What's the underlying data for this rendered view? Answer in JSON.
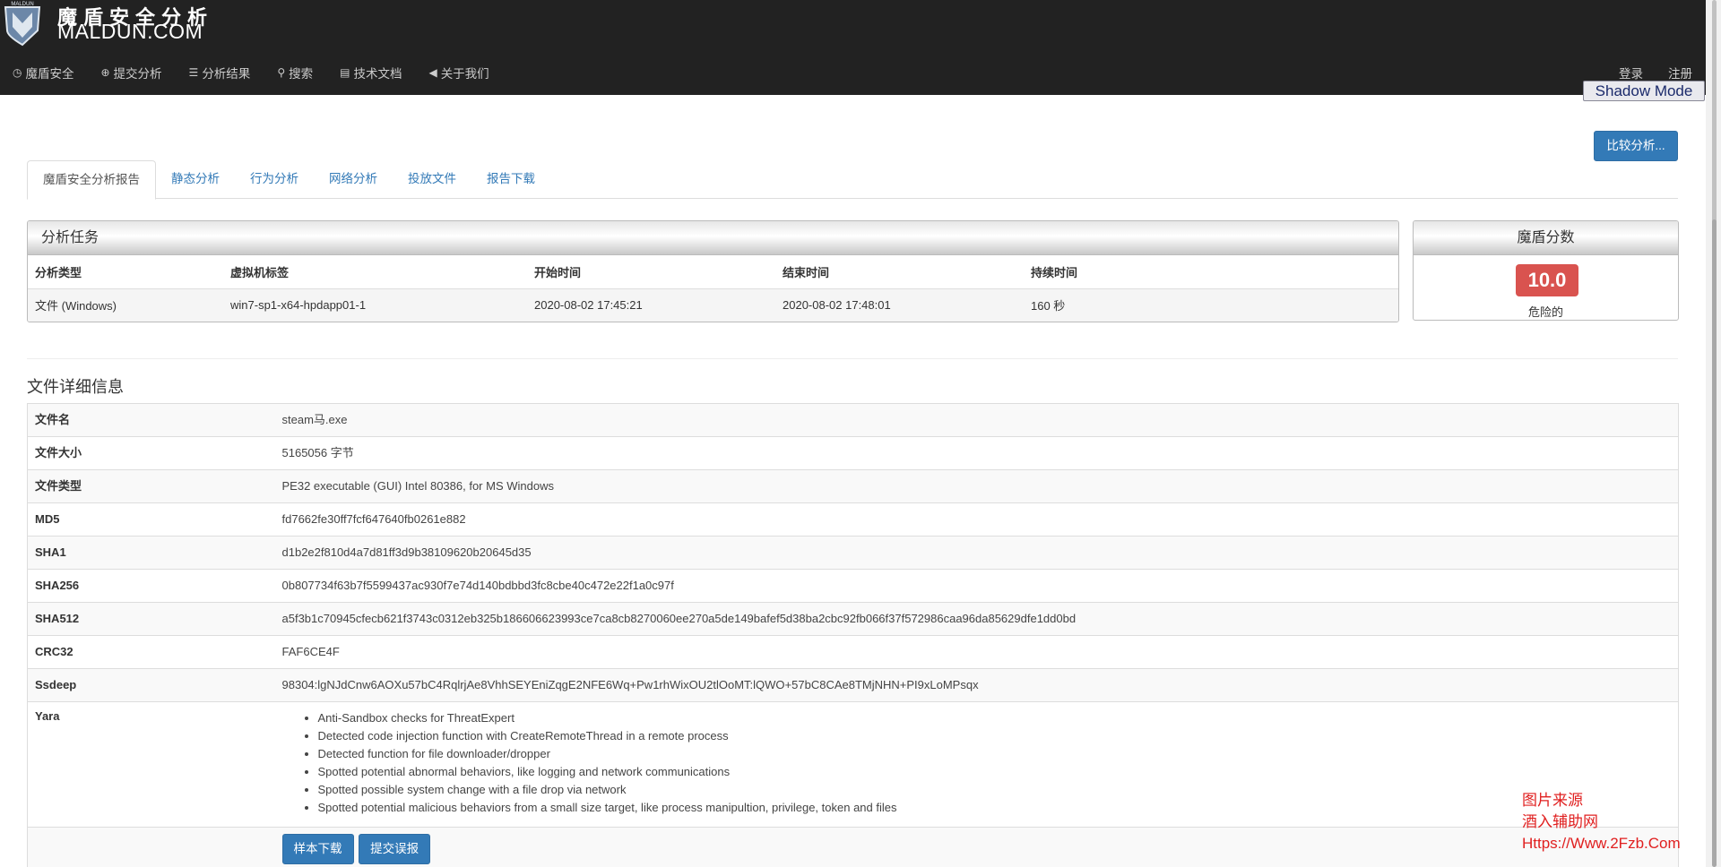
{
  "brand": {
    "name_cn": "魔盾安全分析",
    "name_en": "MALDUN.COM",
    "logo_text": "MALDUN"
  },
  "nav": [
    {
      "icon": "dashboard-icon",
      "label": "魔盾安全"
    },
    {
      "icon": "upload-icon",
      "label": "提交分析"
    },
    {
      "icon": "list-icon",
      "label": "分析结果"
    },
    {
      "icon": "search-icon",
      "label": "搜索"
    },
    {
      "icon": "document-icon",
      "label": "技术文档"
    },
    {
      "icon": "bullhorn-icon",
      "label": "关于我们"
    }
  ],
  "nav_right": {
    "login": "登录",
    "register": "注册"
  },
  "shadow_mode": "Shadow Mode",
  "compare_button": "比较分析...",
  "tabs": [
    "魔盾安全分析报告",
    "静态分析",
    "行为分析",
    "网络分析",
    "投放文件",
    "报告下载"
  ],
  "task": {
    "title": "分析任务",
    "headers": [
      "分析类型",
      "虚拟机标签",
      "开始时间",
      "结束时间",
      "持续时间"
    ],
    "row": [
      "文件 (Windows)",
      "win7-sp1-x64-hpdapp01-1",
      "2020-08-02 17:45:21",
      "2020-08-02 17:48:01",
      "160 秒"
    ]
  },
  "score": {
    "title": "魔盾分数",
    "value": "10.0",
    "label": "危险的",
    "color": "#d9534f"
  },
  "file_info": {
    "title": "文件详细信息",
    "rows": [
      {
        "key": "文件名",
        "value": "steam马.exe"
      },
      {
        "key": "文件大小",
        "value": "5165056 字节"
      },
      {
        "key": "文件类型",
        "value": "PE32 executable (GUI) Intel 80386, for MS Windows"
      },
      {
        "key": "MD5",
        "value": "fd7662fe30ff7fcf647640fb0261e882"
      },
      {
        "key": "SHA1",
        "value": "d1b2e2f810d4a7d81ff3d9b38109620b20645d35"
      },
      {
        "key": "SHA256",
        "value": "0b807734f63b7f5599437ac930f7e74d140bdbbd3fc8cbe40c472e22f1a0c97f"
      },
      {
        "key": "SHA512",
        "value": "a5f3b1c70945cfecb621f3743c0312eb325b186606623993ce7ca8cb8270060ee270a5de149bafef5d38ba2cbc92fb066f37f572986caa96da85629dfe1dd0bd"
      },
      {
        "key": "CRC32",
        "value": "FAF6CE4F"
      },
      {
        "key": "Ssdeep",
        "value": "98304:lgNJdCnw6AOXu57bC4RqlrjAe8VhhSEYEniZqgE2NFE6Wq+Pw1rhWixOU2tlOoMT:lQWO+57bC8CAe8TMjNHN+PI9xLoMPsqx"
      }
    ],
    "yara_label": "Yara",
    "yara": [
      "Anti-Sandbox checks for ThreatExpert",
      "Detected code injection function with CreateRemoteThread in a remote process",
      "Detected function for file downloader/dropper",
      "Spotted potential abnormal behaviors, like logging and network communications",
      "Spotted possible system change with a file drop via network",
      "Spotted potential malicious behaviors from a small size target, like process manipultion, privilege, token and files"
    ],
    "actions": {
      "download": "样本下载",
      "report_error": "提交误报"
    }
  },
  "watermark": [
    "图片来源",
    "酒入辅助网",
    "Https://Www.2Fzb.Com"
  ]
}
